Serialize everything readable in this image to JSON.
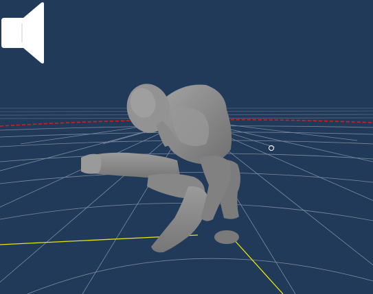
{
  "scene": {
    "background_color": "#223a59",
    "grid_color": "#9aa7b8",
    "horizon_axis_color": "#d02020",
    "ground_axis_color": "#e8e800",
    "model_color": "#8a8a8a"
  },
  "controls": {
    "mute_icon": "speaker-muted-icon",
    "pivot_icon": "orbit-pivot-ring-icon"
  }
}
